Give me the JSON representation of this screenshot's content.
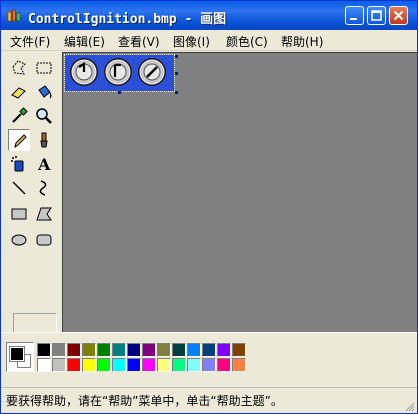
{
  "window": {
    "title": "ControlIgnition.bmp - 画图"
  },
  "menu": [
    {
      "label": "文件(F)"
    },
    {
      "label": "编辑(E)"
    },
    {
      "label": "查看(V)"
    },
    {
      "label": "图像(I)"
    },
    {
      "label": "颜色(C)"
    },
    {
      "label": "帮助(H)"
    }
  ],
  "tools": [
    {
      "name": "free-select-icon"
    },
    {
      "name": "rect-select-icon"
    },
    {
      "name": "eraser-icon"
    },
    {
      "name": "fill-bucket-icon"
    },
    {
      "name": "color-picker-icon"
    },
    {
      "name": "magnifier-icon"
    },
    {
      "name": "pencil-icon"
    },
    {
      "name": "brush-icon"
    },
    {
      "name": "airbrush-icon"
    },
    {
      "name": "text-icon"
    },
    {
      "name": "line-icon"
    },
    {
      "name": "curve-icon"
    },
    {
      "name": "rectangle-icon"
    },
    {
      "name": "polygon-icon"
    },
    {
      "name": "ellipse-icon"
    },
    {
      "name": "rounded-rect-icon"
    }
  ],
  "active_tool": "pencil-icon",
  "colors": {
    "foreground": "#000000",
    "background": "#ffffff",
    "top_row": [
      "#000000",
      "#808080",
      "#800000",
      "#808000",
      "#008000",
      "#008080",
      "#000080",
      "#800080",
      "#808040",
      "#004040",
      "#0080ff",
      "#004080",
      "#8000ff",
      "#804000"
    ],
    "bottom_row": [
      "#ffffff",
      "#c0c0c0",
      "#ff0000",
      "#ffff00",
      "#00ff00",
      "#00ffff",
      "#0000ff",
      "#ff00ff",
      "#ffff80",
      "#00ff80",
      "#80ffff",
      "#8080ff",
      "#ff0080",
      "#ff8040"
    ]
  },
  "status": {
    "text": "要获得帮助，请在“帮助”菜单中，单击“帮助主题”。"
  }
}
